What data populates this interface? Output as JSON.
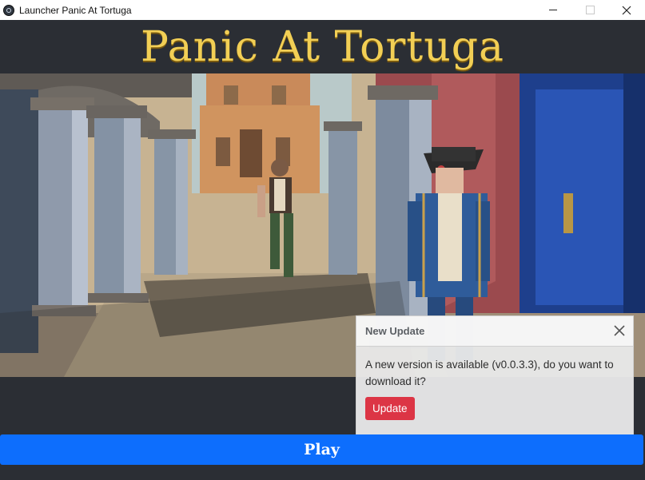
{
  "window": {
    "title": "Launcher Panic At Tortuga",
    "icon": "electron-icon",
    "controls": [
      "minimize-icon",
      "maximize-icon",
      "close-icon"
    ]
  },
  "header": {
    "game_title": "Panic At Tortuga",
    "title_color": "#f2cf55"
  },
  "banner": {
    "image": "game-scene-pirates-courtyard"
  },
  "toast": {
    "title": "New Update",
    "message": "A new version is available (v0.0.3.3), do you want to download it?",
    "button_label": "Update",
    "button_color": "#dc3545"
  },
  "play": {
    "label": "Play",
    "color": "#0d6efd"
  }
}
